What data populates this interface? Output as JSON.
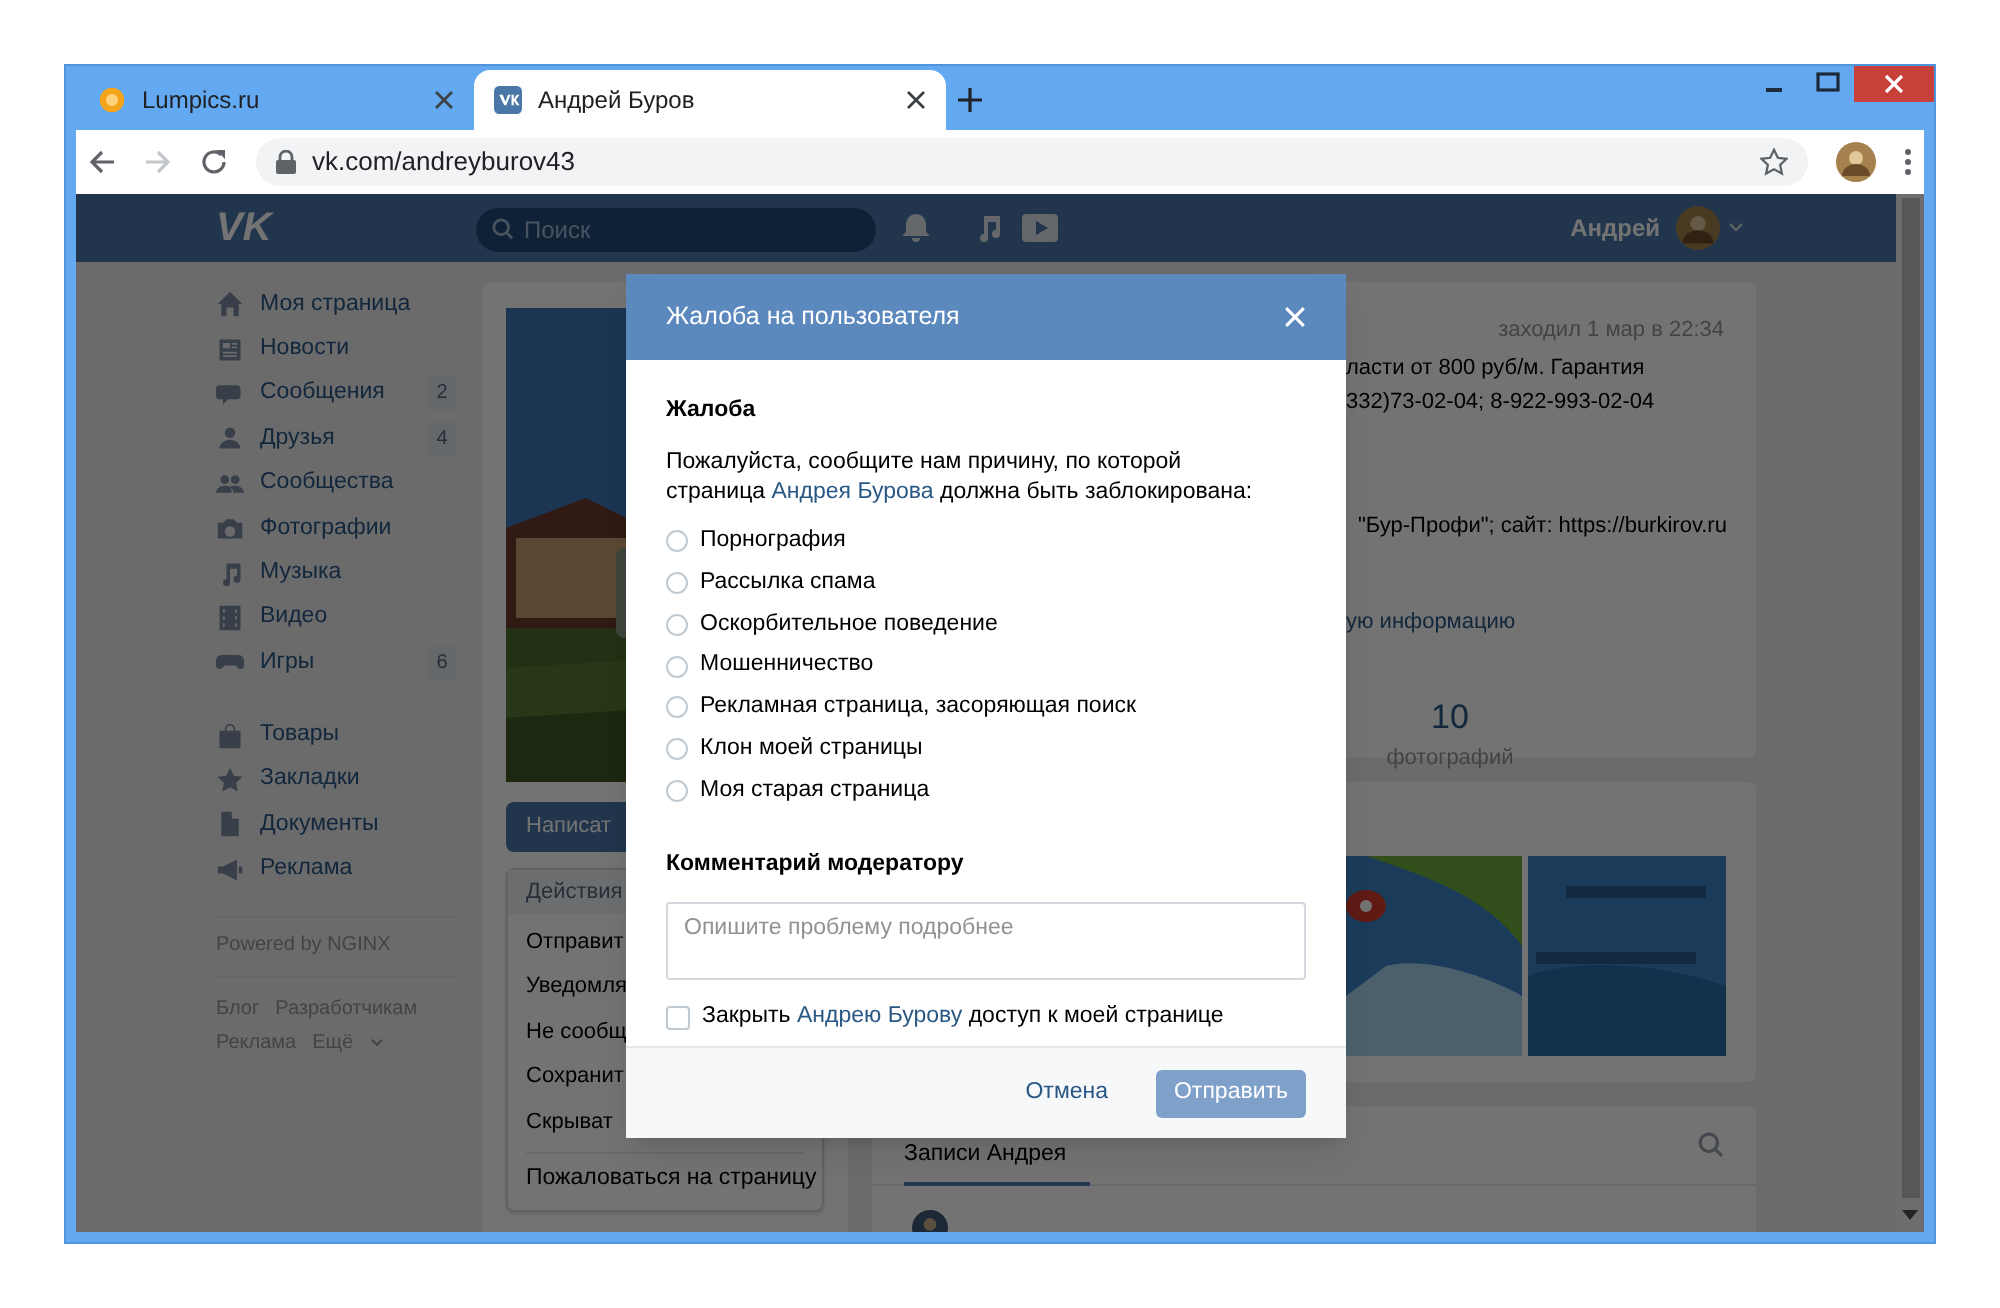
{
  "browser": {
    "tabs": [
      {
        "title": "Lumpics.ru",
        "selected": false
      },
      {
        "title": "Андрей Буров",
        "selected": true
      }
    ],
    "url": "vk.com/andreyburov43",
    "forward_disabled": true
  },
  "header": {
    "logo": "VK",
    "search_placeholder": "Поиск",
    "user_name": "Андрей"
  },
  "sidebar": {
    "sections": [
      {
        "items": [
          {
            "label": "Моя страница"
          },
          {
            "label": "Новости"
          },
          {
            "label": "Сообщения",
            "count": "2"
          },
          {
            "label": "Друзья",
            "count": "4"
          },
          {
            "label": "Сообщества"
          },
          {
            "label": "Фотографии"
          },
          {
            "label": "Музыка"
          },
          {
            "label": "Видео"
          },
          {
            "label": "Игры",
            "count": "6"
          }
        ]
      },
      {
        "items": [
          {
            "label": "Товары"
          },
          {
            "label": "Закладки"
          },
          {
            "label": "Документы"
          },
          {
            "label": "Реклама"
          }
        ]
      }
    ],
    "powered_by": "Powered by NGINX",
    "footer_links": [
      "Блог",
      "Разработчикам",
      "Реклама",
      "Ещё"
    ]
  },
  "profile": {
    "write_button": "Написат",
    "actions_menu": {
      "header": "Действия",
      "items": [
        "Отправит",
        "Уведомля",
        "Не сообщ",
        "Сохранит",
        "Скрыват"
      ],
      "report": "Пожаловаться на страницу"
    }
  },
  "info": {
    "last_seen": "заходил 1 мар в 22:34",
    "lines": [
      "ласти от 800 руб/м. Гарантия",
      "332)73-02-04; 8-922-993-02-04"
    ],
    "company": "\"Бур-Профи\"; сайт: https://burkirov.ru",
    "more": "ую информацию",
    "counter": {
      "value": "10",
      "label": "фотографий"
    }
  },
  "wall": {
    "tab": "Записи Андрея"
  },
  "dialog": {
    "title": "Жалоба на пользователя",
    "section": "Жалоба",
    "prompt": {
      "before": "Пожалуйста, сообщите нам причину, по которой страница",
      "link": "Андрея Бурова",
      "after": "должна быть заблокирована:"
    },
    "reasons": [
      {
        "label": "Порнография",
        "selected": false
      },
      {
        "label": "Рассылка спама",
        "selected": false
      },
      {
        "label": "Оскорбительное поведение",
        "selected": false
      },
      {
        "label": "Мошенничество",
        "selected": false
      },
      {
        "label": "Рекламная страница, засоряющая поиск",
        "selected": false
      },
      {
        "label": "Клон моей страницы",
        "selected": false
      },
      {
        "label": "Моя старая страница",
        "selected": false
      }
    ],
    "comment_label": "Комментарий модератору",
    "comment_placeholder": "Опишите проблему подробнее",
    "block": {
      "checked": false,
      "before": "Закрыть",
      "link": "Андрею Бурову",
      "after": "доступ к моей странице"
    },
    "cancel": "Отмена",
    "submit": {
      "label": "Отправить",
      "disabled": true
    }
  }
}
